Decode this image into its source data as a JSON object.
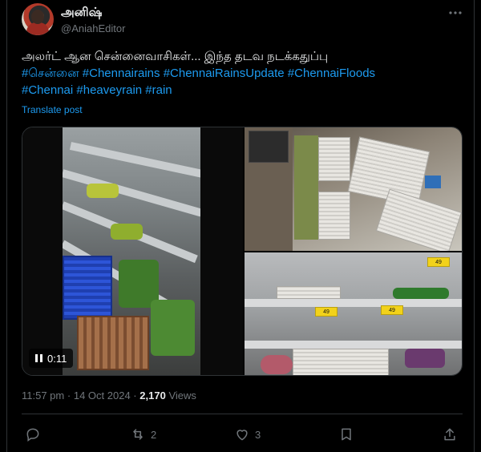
{
  "author": {
    "display_name": "அனிஷ்",
    "handle": "@AniahEditor"
  },
  "tweet": {
    "line1": "அலர்ட் ஆன சென்னைவாசிகள்... இந்த தடவ நடக்கதுப்பு",
    "hashtags_line2": [
      "#சென்னை",
      "#Chennairains",
      "#ChennaiRainsUpdate",
      "#ChennaiFloods"
    ],
    "hashtags_line3": [
      "#Chennai",
      "#heaveyrain",
      "#rain"
    ],
    "translate_label": "Translate post"
  },
  "media": {
    "video_time": "0:11",
    "price_tags": [
      "49",
      "49",
      "49"
    ]
  },
  "meta": {
    "time": "11:57 pm",
    "separator": "·",
    "date": "14 Oct 2024",
    "views_count": "2,170",
    "views_label": "Views"
  },
  "actions": {
    "reply_count": "",
    "repost_count": "2",
    "like_count": "3"
  },
  "icons": [
    "more-icon",
    "reply-icon",
    "repost-icon",
    "like-icon",
    "bookmark-icon",
    "share-icon",
    "pause-icon"
  ],
  "colors": {
    "background": "#000000",
    "text": "#e7e9ea",
    "muted": "#71767b",
    "link": "#1d9bf0",
    "border": "#2f3336"
  }
}
